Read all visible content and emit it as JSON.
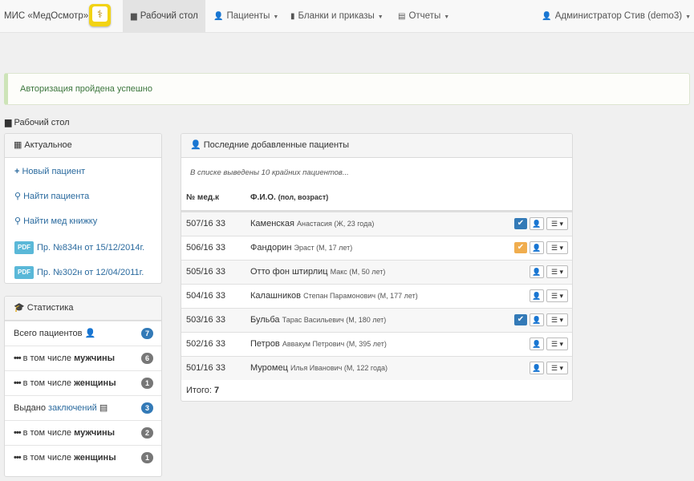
{
  "navbar": {
    "brand": "МИС «МедОсмотр»",
    "logo_icon": "medical-caduceus-icon",
    "items": [
      {
        "label": "Рабочий стол",
        "icon": "desktop-icon",
        "active": true,
        "has_caret": false
      },
      {
        "label": "Пациенты",
        "icon": "user-icon",
        "active": false,
        "has_caret": true
      },
      {
        "label": "Бланки и приказы",
        "icon": "book-icon",
        "active": false,
        "has_caret": true
      },
      {
        "label": "Отчеты",
        "icon": "list-icon",
        "active": false,
        "has_caret": true
      }
    ],
    "user": "Администратор Стив (demo3)",
    "user_caret": "▼"
  },
  "alert": {
    "text": "Авторизация пройдена успешно"
  },
  "page": {
    "title": "Рабочий стол"
  },
  "actual": {
    "title": "Актуальное",
    "links": [
      {
        "prefix": "+",
        "label": "Новый пациент",
        "icon": "plus-icon"
      },
      {
        "prefix": "⚲",
        "label": "Найти пациента",
        "icon": "search-icon"
      },
      {
        "prefix": "⚲",
        "label": "Найти мед книжку",
        "icon": "search-icon"
      },
      {
        "prefix": "PDF",
        "label": "Пр. №834н от 15/12/2014г.",
        "icon": "pdf-icon"
      },
      {
        "prefix": "PDF",
        "label": "Пр. №302н от 12/04/2011г.",
        "icon": "pdf-icon"
      }
    ]
  },
  "stats": {
    "title": "Статистика",
    "rows": [
      {
        "label": "Всего пациентов",
        "bold": "",
        "link": "",
        "count": "7",
        "badge_color": "#337ab7"
      },
      {
        "label": "в том числе",
        "bold": "мужчины",
        "link": "",
        "count": "6",
        "badge_color": "#777777"
      },
      {
        "label": "в том числе",
        "bold": "женщины",
        "link": "",
        "count": "1",
        "badge_color": "#777777"
      },
      {
        "label": "Выдано",
        "bold": "",
        "link": "заключений",
        "count": "3",
        "badge_color": "#337ab7"
      },
      {
        "label": "в том числе",
        "bold": "мужчины",
        "link": "",
        "count": "2",
        "badge_color": "#777777"
      },
      {
        "label": "в том числе",
        "bold": "женщины",
        "link": "",
        "count": "1",
        "badge_color": "#777777"
      }
    ]
  },
  "patients": {
    "title": "Последние добавленные пациенты",
    "note": "В списке выведены 10 крайних пациентов...",
    "col_med": "№ мед.к",
    "col_fio": "Ф.И.О.",
    "col_fio_sub": "(пол, возраст)",
    "rows": [
      {
        "med": "507/16 33",
        "surname": "Каменская",
        "rest": "Анастасия (Ж, 23 года)",
        "check": "blue"
      },
      {
        "med": "506/16 33",
        "surname": "Фандорин",
        "rest": "Эраст (М, 17 лет)",
        "check": "orange"
      },
      {
        "med": "505/16 33",
        "surname": "Отто фон штирлиц",
        "rest": "Макс (М, 50 лет)",
        "check": ""
      },
      {
        "med": "504/16 33",
        "surname": "Калашников",
        "rest": "Степан Парамонович (М, 177 лет)",
        "check": ""
      },
      {
        "med": "503/16 33",
        "surname": "Бульба",
        "rest": "Тарас Васильевич (М, 180 лет)",
        "check": "blue"
      },
      {
        "med": "502/16 33",
        "surname": "Петров",
        "rest": "Аввакум Петрович (М, 395 лет)",
        "check": ""
      },
      {
        "med": "501/16 33",
        "surname": "Муромец",
        "rest": "Илья Иванович (М, 122 года)",
        "check": ""
      }
    ],
    "total_label": "Итого:",
    "total_value": "7"
  },
  "colors": {
    "accent": "#337ab7",
    "logo": "#f2d314",
    "check_blue": "#337ab7",
    "check_orange": "#f0ad4e"
  }
}
